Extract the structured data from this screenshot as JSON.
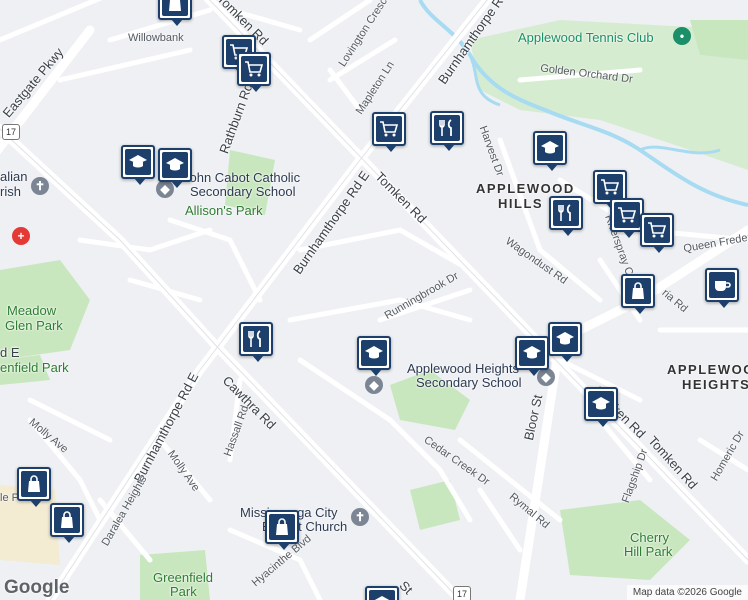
{
  "map": {
    "streets": {
      "tomken_rd_top": "Tomken Rd",
      "burnhamthorpe_top": "Burnhamthorpe Rd E",
      "willowbank": "Willowbank",
      "lovington": "Lovington Crescent",
      "mapleton": "Mapleton Ln",
      "golden_orchard": "Golden Orchard Dr",
      "harvest": "Harvest Dr",
      "rathburn": "Rathburn Rd E",
      "eastgate": "Eastgate Pkwy",
      "tomken_mid": "Tomken Rd",
      "burnhamthorpe_mid": "Burnhamthorpe Rd E",
      "wagondust": "Wagondust Rd",
      "queen_frederica": "Queen Frederica",
      "riverspray": "Riverspray Crescent",
      "runningbrook": "Runningbrook Dr",
      "cawthra": "Cawthra Rd",
      "burnhamthorpe_left": "Burnhamthorpe Rd E",
      "hassall": "Hassall Rd",
      "molly_ave_1": "Molly Ave",
      "molly_ave_2": "Molly Ave",
      "daralea": "Daralea Heights",
      "bloor": "Bloor St",
      "tomken_low": "Tomken Rd",
      "tomken_right": "Tomken Rd",
      "cedar_creek": "Cedar Creek Dr",
      "rymal": "Rymal Rd",
      "flagship": "Flagship Dr",
      "homeric": "Homeric Dr",
      "hyacinthe": "Hyacinthe Blvd",
      "st_bottom": "St",
      "rd_e_left": "d E",
      "bottom_left_partial": "le Pa",
      "rica_partial": "ria Rd"
    },
    "places": {
      "tennis_club": "Applewood Tennis Club",
      "applewood_hills_1": "APPLEWOOD",
      "applewood_hills_2": "HILLS",
      "applewood_heights_1": "APPLEWOOD",
      "applewood_heights_2": "HEIGHTS",
      "john_cabot_1": "John Cabot Catholic",
      "john_cabot_2": "Secondary School",
      "allisons_park": "Allison's Park",
      "meadow_glen_1": "Meadow",
      "meadow_glen_2": "Glen Park",
      "fenfield": "enfield Park",
      "applewood_secondary_1": "Applewood Heights",
      "applewood_secondary_2": "Secondary School",
      "miss_church_1": "Mississauga City",
      "miss_church_2": "Baptist Church",
      "greenfield_1": "Greenfield",
      "greenfield_2": "Park",
      "cherry_hill_1": "Cherry",
      "cherry_hill_2": "Hill Park",
      "left_partial_1": "alian",
      "left_partial_2": "rish"
    },
    "route_shields": {
      "r17_top": "17",
      "r17_bottom": "17"
    },
    "markers": [
      {
        "icon": "shopping-bag-icon"
      },
      {
        "icon": "grocery-cart-icon"
      },
      {
        "icon": "grocery-cart-icon"
      },
      {
        "icon": "school-icon"
      },
      {
        "icon": "school-icon"
      },
      {
        "icon": "grocery-cart-icon"
      },
      {
        "icon": "restaurant-icon"
      },
      {
        "icon": "school-icon"
      },
      {
        "icon": "grocery-cart-icon"
      },
      {
        "icon": "restaurant-icon"
      },
      {
        "icon": "grocery-cart-icon"
      },
      {
        "icon": "grocery-cart-icon"
      },
      {
        "icon": "shopping-bag-icon"
      },
      {
        "icon": "cafe-icon"
      },
      {
        "icon": "restaurant-icon"
      },
      {
        "icon": "school-icon"
      },
      {
        "icon": "school-icon"
      },
      {
        "icon": "school-icon"
      },
      {
        "icon": "school-icon"
      },
      {
        "icon": "shopping-bag-icon"
      },
      {
        "icon": "shopping-bag-icon"
      },
      {
        "icon": "shopping-bag-icon"
      },
      {
        "icon": "school-icon"
      }
    ],
    "attribution": "Map data ©2026 Google",
    "logo": "Google",
    "colors": {
      "marker_border": "#1d3f6b",
      "park_green": "#c9e7bf",
      "water_blue": "#a6dbf2",
      "road": "#ffffff"
    }
  }
}
